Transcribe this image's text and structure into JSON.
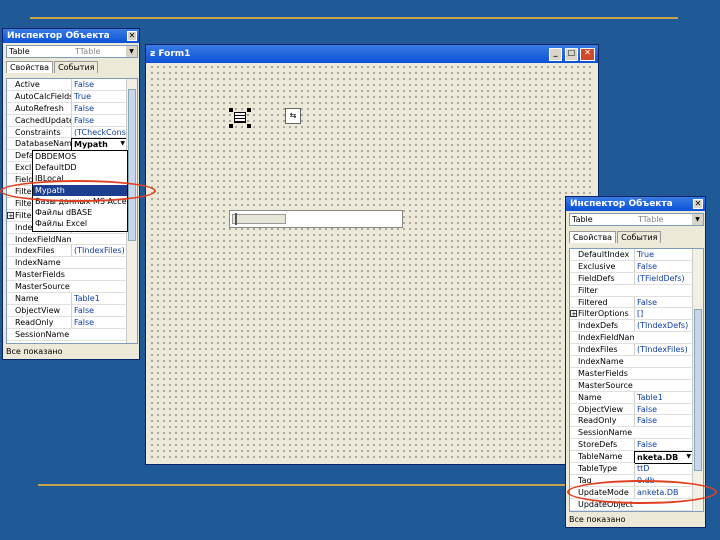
{
  "colors": {
    "desktop": "#1f5a96",
    "rule": "#c8a24a",
    "titlebar": "#0a51d8",
    "highlight": "#1c3e8e",
    "annotation": "#e04020"
  },
  "inspector1": {
    "title": "Инспектор Объекта",
    "object_name": "Table",
    "object_type": "TTable",
    "tabs": [
      "Свойства",
      "События"
    ],
    "rows": [
      {
        "name": "Active",
        "value": "False"
      },
      {
        "name": "AutoCalcFields",
        "value": "True"
      },
      {
        "name": "AutoRefresh",
        "value": "False"
      },
      {
        "name": "CachedUpdates",
        "value": "False"
      },
      {
        "name": "Constraints",
        "value": "(TCheckConstr"
      },
      {
        "name": "DatabaseName",
        "value": "Mypath"
      },
      {
        "name": "Defa",
        "value": ""
      },
      {
        "name": "Exclu",
        "value": ""
      },
      {
        "name": "Field",
        "value": ""
      },
      {
        "name": "Filter",
        "value": ""
      },
      {
        "name": "Filte",
        "value": ""
      },
      {
        "name": "Filte",
        "value": ""
      },
      {
        "name": "IndexDefs",
        "value": "(TIndexDefs)"
      },
      {
        "name": "IndexFieldNames",
        "value": ""
      },
      {
        "name": "IndexFiles",
        "value": "(TIndexFiles)"
      },
      {
        "name": "IndexName",
        "value": ""
      },
      {
        "name": "MasterFields",
        "value": ""
      },
      {
        "name": "MasterSource",
        "value": ""
      },
      {
        "name": "Name",
        "value": "Table1"
      },
      {
        "name": "ObjectView",
        "value": "False"
      },
      {
        "name": "ReadOnly",
        "value": "False"
      },
      {
        "name": "SessionName",
        "value": ""
      }
    ],
    "dropdown": [
      "DBDEMOS",
      "DefaultDD",
      "IBLocal",
      "Mypath",
      "Базы данных MS Access",
      "Файлы dBASE",
      "Файлы Excel"
    ],
    "status": "Все показано"
  },
  "form": {
    "title": "Form1",
    "buttons": {
      "minimize": "_",
      "maximize": "□",
      "close": "✕"
    }
  },
  "inspector2": {
    "title": "Инспектор Объекта",
    "object_name": "Table",
    "object_type": "TTable",
    "tabs": [
      "Свойства",
      "События"
    ],
    "rows": [
      {
        "name": "DefaultIndex",
        "value": "True"
      },
      {
        "name": "Exclusive",
        "value": "False"
      },
      {
        "name": "FieldDefs",
        "value": "(TFieldDefs)"
      },
      {
        "name": "Filter",
        "value": ""
      },
      {
        "name": "Filtered",
        "value": "False"
      },
      {
        "name": "FilterOptions",
        "value": "[]"
      },
      {
        "name": "IndexDefs",
        "value": "(TIndexDefs)"
      },
      {
        "name": "IndexFieldNam",
        "value": ""
      },
      {
        "name": "IndexFiles",
        "value": "(TIndexFiles)"
      },
      {
        "name": "IndexName",
        "value": ""
      },
      {
        "name": "MasterFields",
        "value": ""
      },
      {
        "name": "MasterSource",
        "value": ""
      },
      {
        "name": "Name",
        "value": "Table1"
      },
      {
        "name": "ObjectView",
        "value": "False"
      },
      {
        "name": "ReadOnly",
        "value": "False"
      },
      {
        "name": "SessionName",
        "value": ""
      },
      {
        "name": "StoreDefs",
        "value": "False"
      },
      {
        "name": "TableName",
        "value": "nketa.DB"
      },
      {
        "name": "TableType",
        "value": "ttD"
      },
      {
        "name": "Tag",
        "value": "0.db"
      },
      {
        "name": "UpdateMode",
        "value": "anketa.DB"
      },
      {
        "name": "UpdateObject",
        "value": ""
      }
    ],
    "status": "Все показано"
  }
}
